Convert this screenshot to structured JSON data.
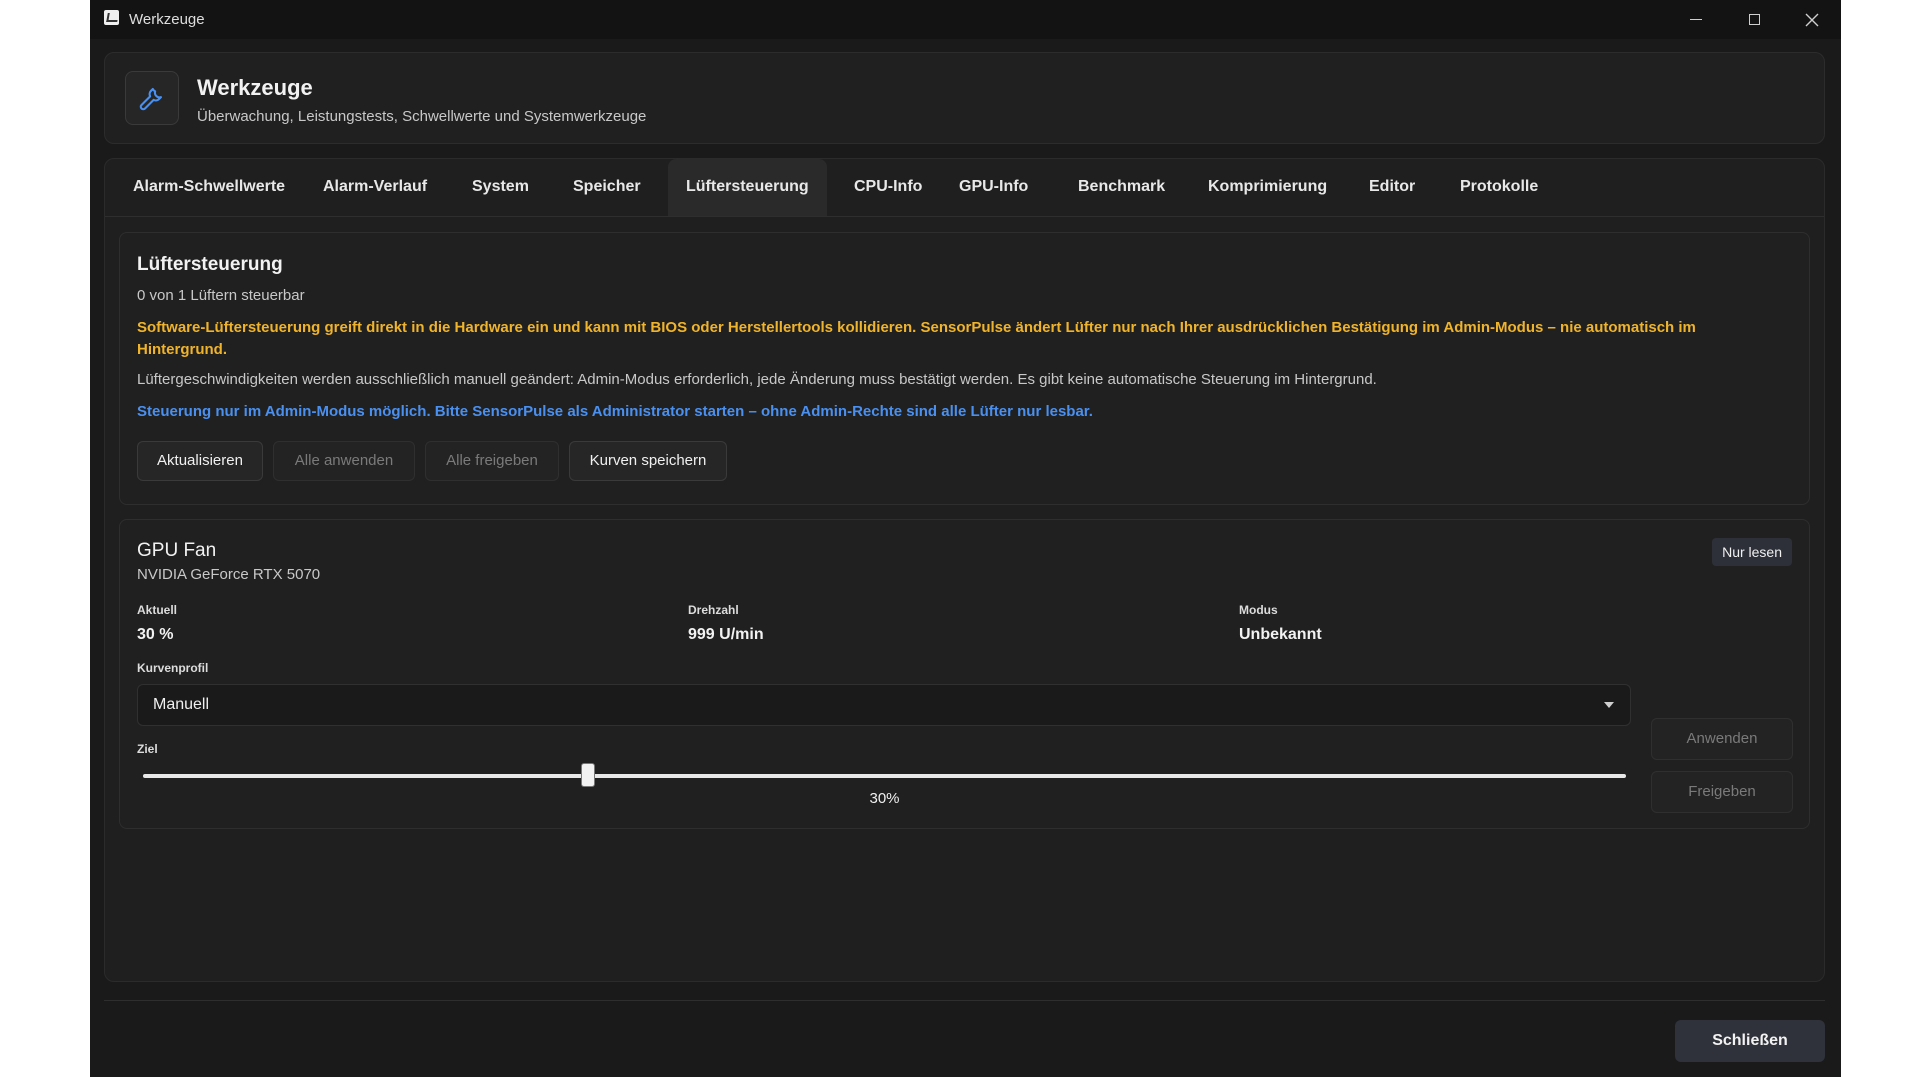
{
  "window": {
    "title": "Werkzeuge"
  },
  "header": {
    "title": "Werkzeuge",
    "subtitle": "Überwachung, Leistungstests, Schwellwerte und Systemwerkzeuge"
  },
  "tabs": [
    {
      "label": "Alarm-Schwellwerte",
      "active": false
    },
    {
      "label": "Alarm-Verlauf",
      "active": false
    },
    {
      "label": "System",
      "active": false
    },
    {
      "label": "Speicher",
      "active": false
    },
    {
      "label": "Lüftersteuerung",
      "active": true
    },
    {
      "label": "CPU-Info",
      "active": false
    },
    {
      "label": "GPU-Info",
      "active": false
    },
    {
      "label": "Benchmark",
      "active": false
    },
    {
      "label": "Komprimierung",
      "active": false
    },
    {
      "label": "Editor",
      "active": false
    },
    {
      "label": "Protokolle",
      "active": false
    }
  ],
  "fan_control": {
    "title": "Lüftersteuerung",
    "summary": "0 von 1 Lüftern steuerbar",
    "warning": "Software-Lüftersteuerung greift direkt in die Hardware ein und kann mit BIOS oder Herstellertools kollidieren. SensorPulse ändert Lüfter nur nach Ihrer ausdrücklichen Bestätigung im Admin-Modus – nie automatisch im Hintergrund.",
    "info": "Lüftergeschwindigkeiten werden ausschließlich manuell geändert: Admin-Modus erforderlich, jede Änderung muss bestätigt werden. Es gibt keine automatische Steuerung im Hintergrund.",
    "admin_notice": "Steuerung nur im Admin-Modus möglich. Bitte SensorPulse als Administrator starten – ohne Admin-Rechte sind alle Lüfter nur lesbar.",
    "buttons": {
      "refresh": "Aktualisieren",
      "apply_all": "Alle anwenden",
      "release_all": "Alle freigeben",
      "save_curves": "Kurven speichern"
    }
  },
  "fan": {
    "name": "GPU Fan",
    "device": "NVIDIA GeForce RTX 5070",
    "badge": "Nur lesen",
    "current_label": "Aktuell",
    "current_value": "30 %",
    "rpm_label": "Drehzahl",
    "rpm_value": "999 U/min",
    "mode_label": "Modus",
    "mode_value": "Unbekannt",
    "curve_label": "Kurvenprofil",
    "curve_value": "Manuell",
    "target_label": "Ziel",
    "target_value": "30%",
    "target_fraction": 0.3,
    "apply": "Anwenden",
    "release": "Freigeben"
  },
  "footer": {
    "close": "Schließen"
  },
  "colors": {
    "background": "#1a1a1a",
    "warning": "#f0b42c",
    "link": "#4a90f0",
    "badge": "#2d3039"
  }
}
